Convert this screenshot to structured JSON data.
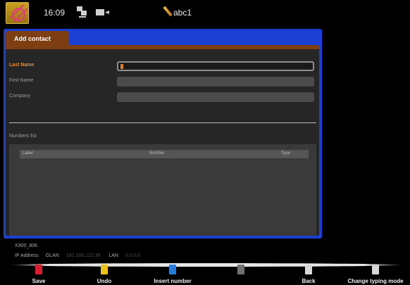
{
  "status_bar": {
    "time": "16:09",
    "icons": [
      "app-logo-icon",
      "network-icon",
      "video-icon",
      "pen-icon"
    ],
    "typing_mode": "abc1"
  },
  "screen": {
    "tab_label": "Add contact",
    "fields": [
      {
        "label": "Last Name",
        "value": "",
        "active": true
      },
      {
        "label": "First Name",
        "value": "",
        "active": false
      },
      {
        "label": "Company",
        "value": "",
        "active": false
      }
    ],
    "numbers_list": {
      "title": "Numbers list",
      "columns": [
        "Label",
        "Number",
        "Type"
      ],
      "rows": []
    }
  },
  "device": {
    "name": "X300_806",
    "ip_label": "IP Address",
    "glan_label": "GLAN",
    "glan_value": "192.168.122.39",
    "lan_label": "LAN",
    "lan_value": "0.0.0.0"
  },
  "softkeys": [
    {
      "label": "Save",
      "color": "#d81e2e"
    },
    {
      "label": "Undo",
      "color": "#eac21a"
    },
    {
      "label": "Insert number",
      "color": "#2a7ad8"
    },
    {
      "label": "",
      "color": "#707070"
    },
    {
      "label": "Back",
      "color": "#d8d8d8"
    },
    {
      "label": "Change typing mode",
      "color": "#d8d8d8"
    }
  ],
  "colors": {
    "accent_blue": "#1b3fd2",
    "tab_brown": "#7e3e12",
    "active_label": "#f08a1e"
  }
}
